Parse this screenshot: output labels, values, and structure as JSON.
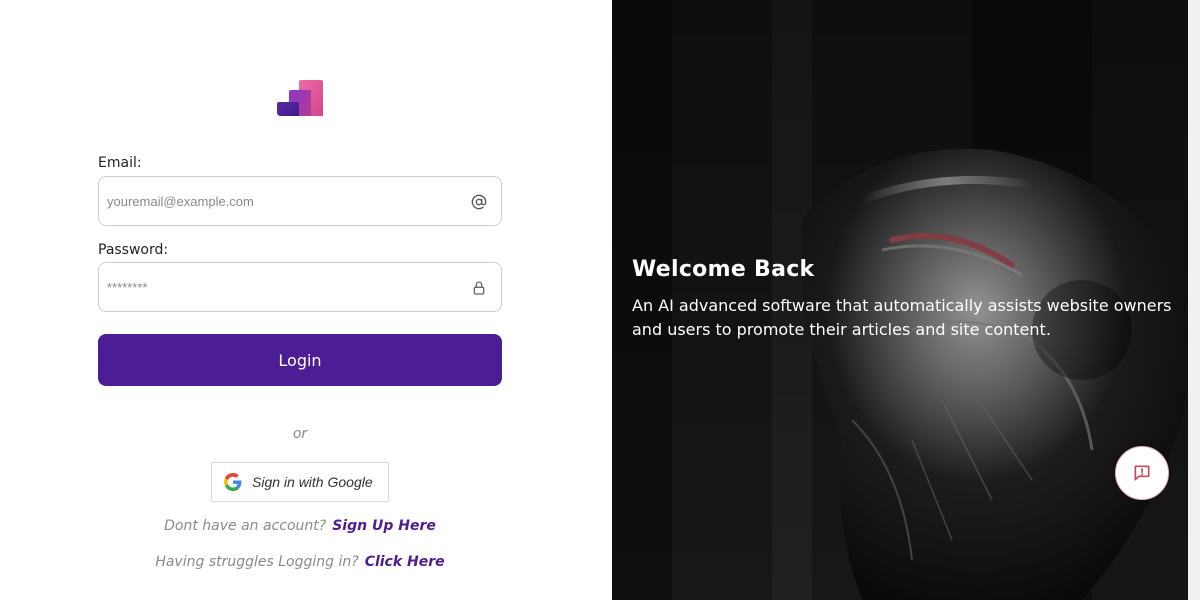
{
  "form": {
    "email_label": "Email:",
    "email_placeholder": "youremail@example.com",
    "email_value": "",
    "password_label": "Password:",
    "password_placeholder": "********",
    "password_value": "",
    "login_label": "Login",
    "or_text": "or",
    "google_label": "Sign in with Google",
    "signup_prompt": "Dont have an account?",
    "signup_link": "Sign Up Here",
    "help_prompt": "Having struggles Logging in?",
    "help_link": "Click Here"
  },
  "hero": {
    "title": "Welcome Back",
    "tagline": "An AI advanced software that automatically assists website owners and users to promote their articles and site content."
  },
  "icons": {
    "email": "at-sign-icon",
    "password": "lock-icon",
    "google": "google-g-icon",
    "feedback": "message-alert-icon",
    "logo": "brand-logo"
  },
  "colors": {
    "primary": "#4c1d95",
    "logo_pink": "#e0559b",
    "logo_purple": "#6a2db4",
    "feedback_icon": "#c94b57"
  }
}
